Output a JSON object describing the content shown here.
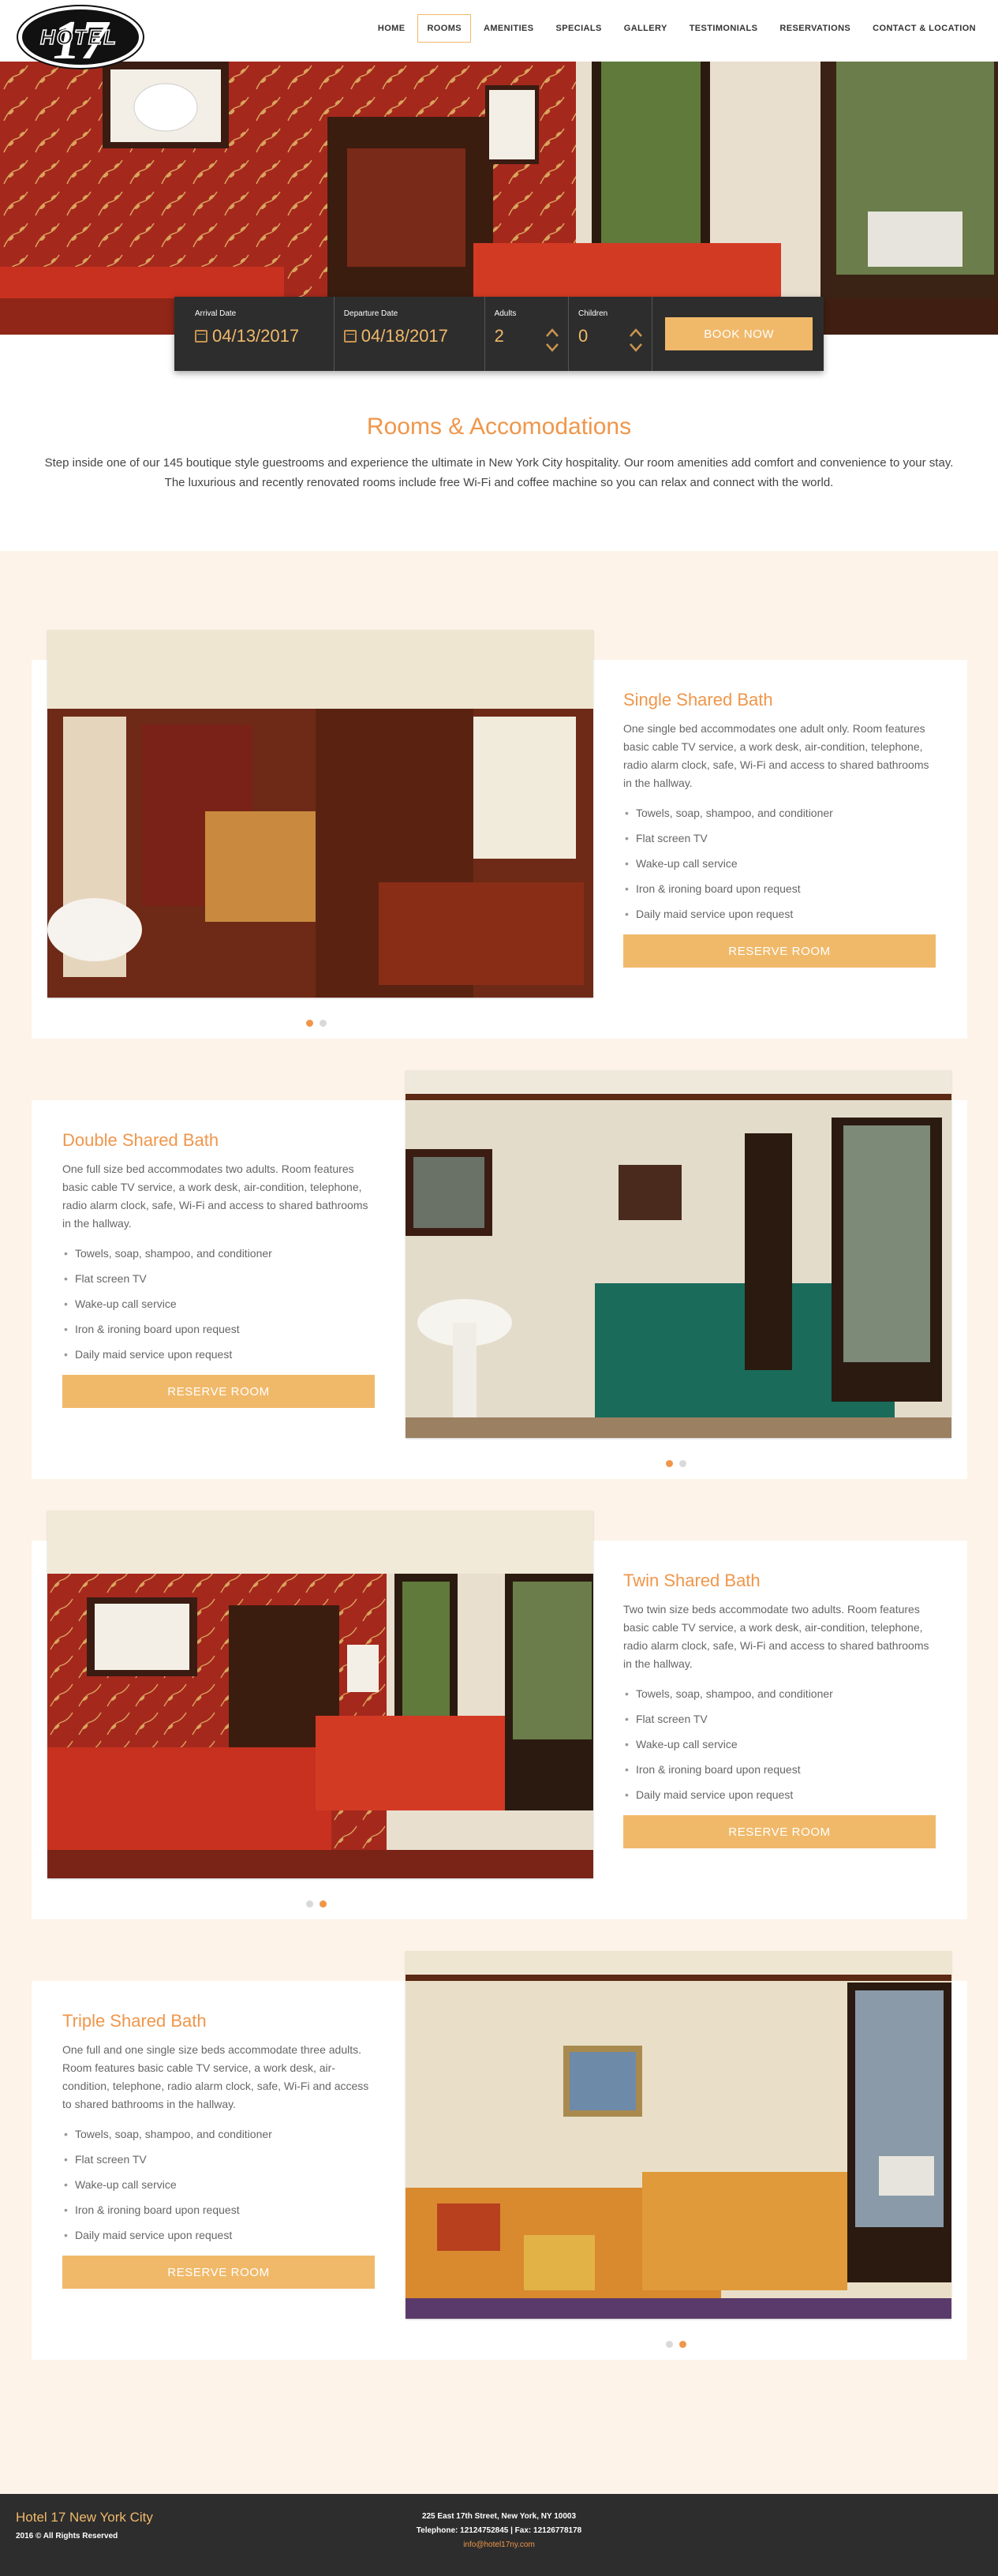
{
  "logo": {
    "text": "HOTEL 17"
  },
  "nav": {
    "items": [
      "HOME",
      "ROOMS",
      "AMENITIES",
      "SPECIALS",
      "GALLERY",
      "TESTIMONIALS",
      "RESERVATIONS",
      "CONTACT & LOCATION"
    ],
    "active": "ROOMS"
  },
  "booking": {
    "arrival_label": "Arrival Date",
    "arrival_value": "04/13/2017",
    "departure_label": "Departure Date",
    "departure_value": "04/18/2017",
    "adults_label": "Adults",
    "adults_value": "2",
    "children_label": "Children",
    "children_value": "0",
    "book_label": "BOOK NOW"
  },
  "intro": {
    "title": "Rooms & Accomodations",
    "text": "Step inside one of our 145 boutique style guestrooms and experience the ultimate in New York City hospitality. Our room amenities add comfort and convenience to your stay. The luxurious and recently renovated rooms include free Wi-Fi and coffee machine so you can relax and connect with the world."
  },
  "rooms": [
    {
      "title": "Single Shared Bath",
      "description": "One single bed accommodates one adult only. Room features basic cable TV service, a work desk, air-condition, telephone, radio alarm clock, safe, Wi-Fi and access to shared bathrooms in the hallway.",
      "amenities": [
        "Towels, soap, shampoo, and conditioner",
        "Flat screen TV",
        "Wake-up call service",
        "Iron & ironing board upon request",
        "Daily maid service upon request"
      ],
      "button": "RESERVE ROOM"
    },
    {
      "title": "Double Shared Bath",
      "description": "One full size bed accommodates two adults. Room features basic cable TV service, a work desk, air-condition, telephone, radio alarm clock, safe, Wi-Fi and access to shared bathrooms in the hallway.",
      "amenities": [
        "Towels, soap, shampoo, and conditioner",
        "Flat screen TV",
        "Wake-up call service",
        "Iron & ironing board upon request",
        "Daily maid service upon request"
      ],
      "button": "RESERVE ROOM"
    },
    {
      "title": "Twin Shared Bath",
      "description": "Two twin size beds accommodate two adults. Room features basic cable TV service, a work desk, air-condition, telephone, radio alarm clock, safe, Wi-Fi and access to shared bathrooms in the hallway.",
      "amenities": [
        "Towels, soap, shampoo, and conditioner",
        "Flat screen TV",
        "Wake-up call service",
        "Iron & ironing board upon request",
        "Daily maid service upon request"
      ],
      "button": "RESERVE ROOM"
    },
    {
      "title": "Triple Shared Bath",
      "description": "One full and one single size beds accommodate three adults. Room features basic cable TV service, a work desk, air-condition, telephone, radio alarm clock, safe, Wi-Fi and access to shared bathrooms in the hallway.",
      "amenities": [
        "Towels, soap, shampoo, and conditioner",
        "Flat screen TV",
        "Wake-up call service",
        "Iron & ironing board upon request",
        "Daily maid service upon request"
      ],
      "button": "RESERVE ROOM"
    }
  ],
  "footer": {
    "title": "Hotel 17 New York City",
    "copyright": "2016 © All Rights Reserved",
    "address": "225 East 17th Street, New York, NY 10003",
    "phone": "Telephone: 12124752845 | Fax: 12126778178",
    "email": "info@hotel17ny.com"
  },
  "colors": {
    "accent": "#f0964a",
    "button": "#f0b96a",
    "dark": "#2d2d2d",
    "cream": "#fdf3e8"
  }
}
